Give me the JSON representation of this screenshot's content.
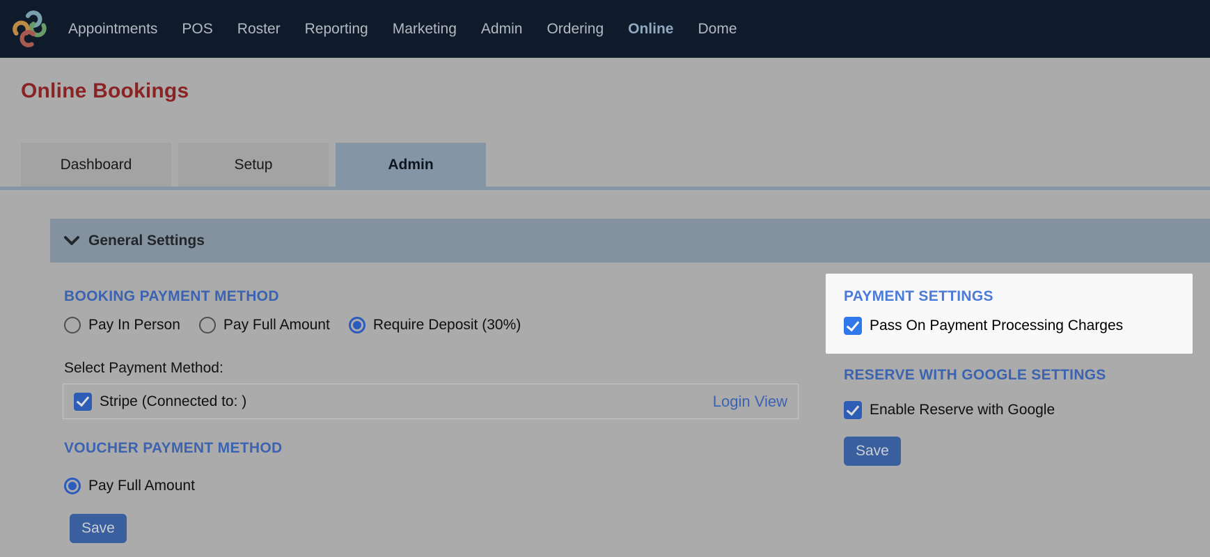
{
  "nav": {
    "items": [
      {
        "label": "Appointments",
        "active": false
      },
      {
        "label": "POS",
        "active": false
      },
      {
        "label": "Roster",
        "active": false
      },
      {
        "label": "Reporting",
        "active": false
      },
      {
        "label": "Marketing",
        "active": false
      },
      {
        "label": "Admin",
        "active": false
      },
      {
        "label": "Ordering",
        "active": false
      },
      {
        "label": "Online",
        "active": true
      },
      {
        "label": "Dome",
        "active": false
      }
    ]
  },
  "page": {
    "title": "Online Bookings"
  },
  "tabs": [
    {
      "label": "Dashboard",
      "active": false
    },
    {
      "label": "Setup",
      "active": false
    },
    {
      "label": "Admin",
      "active": true
    }
  ],
  "general_settings": {
    "label": "General Settings"
  },
  "booking_payment": {
    "heading": "BOOKING PAYMENT METHOD",
    "options": [
      {
        "label": "Pay In Person",
        "selected": false
      },
      {
        "label": "Pay Full Amount",
        "selected": false
      },
      {
        "label": "Require Deposit (30%)",
        "selected": true
      }
    ],
    "select_label": "Select Payment Method:",
    "stripe": {
      "label": "Stripe (Connected to: )",
      "checked": true,
      "link_label": "Login View"
    }
  },
  "voucher_payment": {
    "heading": "VOUCHER PAYMENT METHOD",
    "option": {
      "label": "Pay Full Amount",
      "selected": true
    },
    "save_label": "Save"
  },
  "payment_settings": {
    "heading": "PAYMENT SETTINGS",
    "checkbox": {
      "label": "Pass On Payment Processing Charges",
      "checked": true
    },
    "highlighted": true
  },
  "reserve_google": {
    "heading": "RESERVE WITH GOOGLE SETTINGS",
    "checkbox": {
      "label": "Enable Reserve with Google",
      "checked": true
    },
    "save_label": "Save"
  },
  "icons": {
    "logo": "brand-swirl",
    "general_settings_toggle": "chevron-down",
    "checkbox_mark": "check-mark"
  },
  "colors": {
    "navbar_bg": "#0f1b2b",
    "nav_active": "#8fa9c1",
    "title_red": "#8a2324",
    "tab_active_bg": "#8496a5",
    "section_bar_bg": "#8492a0",
    "heading_blue_dim": "#3b63b0",
    "heading_blue_bright": "#4b7ad9",
    "checkbox_blue_dim": "#2d5db4",
    "checkbox_blue_bright": "#2e78ea",
    "radio_blue": "#2b5bbd",
    "save_button_bg": "#3a5f9e",
    "highlight_bg": "#f9f9f9",
    "page_bg": "#ababab"
  }
}
